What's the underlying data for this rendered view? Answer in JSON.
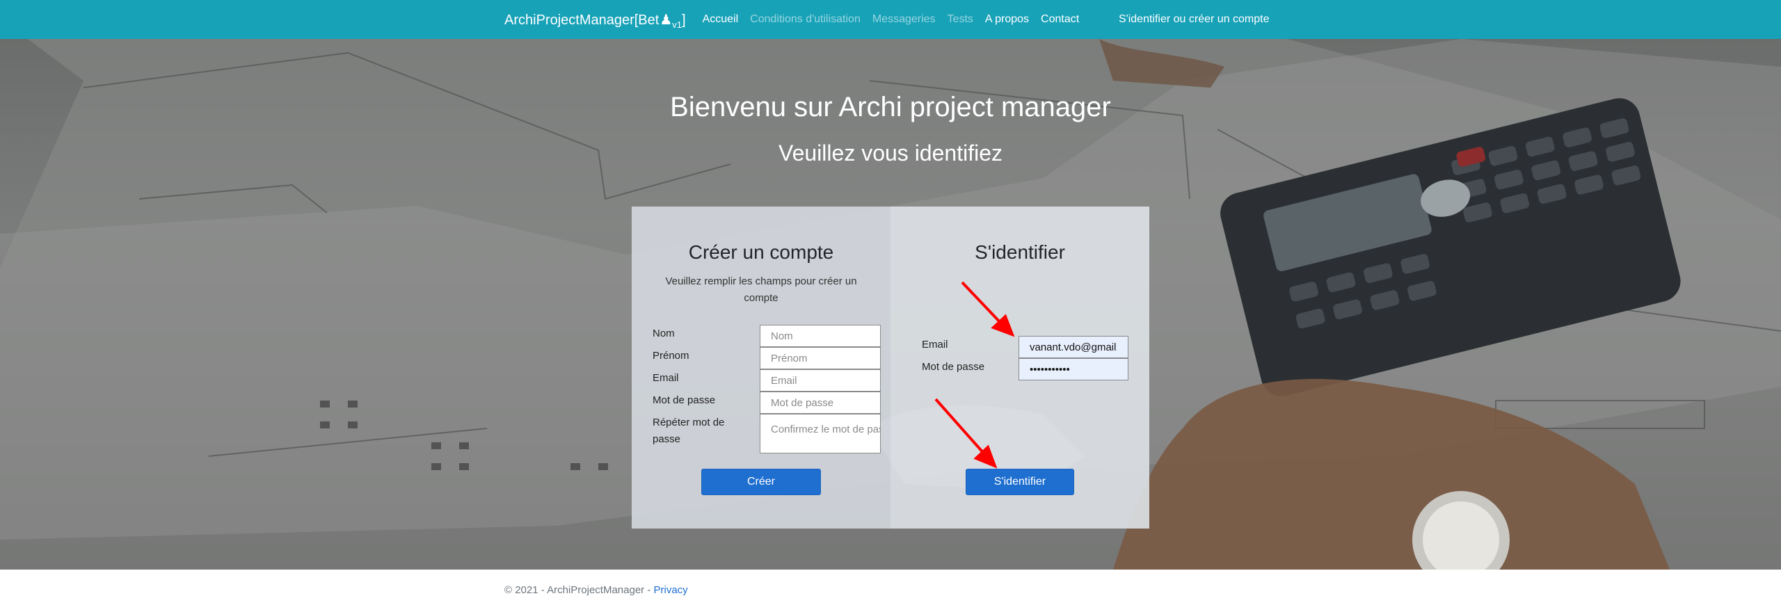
{
  "navbar": {
    "brand_main": "ArchiProjectManager[Bet",
    "brand_pawn": "♟",
    "brand_sub": "v1",
    "brand_close": "]",
    "links": [
      {
        "label": "Accueil",
        "muted": false
      },
      {
        "label": "Conditions d'utilisation",
        "muted": true
      },
      {
        "label": "Messageries",
        "muted": true
      },
      {
        "label": "Tests",
        "muted": true
      },
      {
        "label": "A propos",
        "muted": false
      },
      {
        "label": "Contact",
        "muted": false
      }
    ],
    "account_link": "S'identifier ou créer un compte",
    "color": "#17a2b8"
  },
  "hero": {
    "title": "Bienvenu sur Archi project manager",
    "subtitle": "Veuillez vous identifiez"
  },
  "create_account": {
    "title": "Créer un compte",
    "description": "Veuillez remplir les champs pour créer un compte",
    "fields": {
      "nom": {
        "label": "Nom",
        "placeholder": "Nom"
      },
      "prenom": {
        "label": "Prénom",
        "placeholder": "Prénom"
      },
      "email": {
        "label": "Email",
        "placeholder": "Email"
      },
      "password": {
        "label": "Mot de passe",
        "placeholder": "Mot de passe"
      },
      "repeat": {
        "label": "Répéter mot de passe",
        "placeholder": "Confirmez le mot de passe"
      }
    },
    "submit": "Créer"
  },
  "login": {
    "title": "S'identifier",
    "email_label": "Email",
    "email_value": "vanant.vdo@gmail.com",
    "password_label": "Mot de passe",
    "password_value": "•••••••••••",
    "submit": "S'identifier"
  },
  "footer": {
    "copyright": "© 2021 - ArchiProjectManager - ",
    "privacy": "Privacy"
  },
  "colors": {
    "accent": "#17a2b8",
    "button": "#1f6fd0",
    "annotation_arrow": "#ff0000"
  }
}
